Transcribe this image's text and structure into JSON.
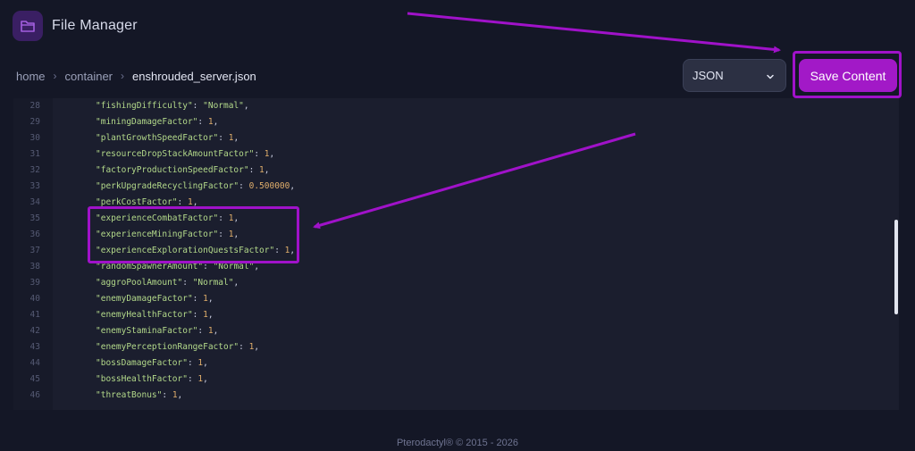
{
  "app": {
    "title": "File Manager",
    "icon": "folder-icon"
  },
  "breadcrumb": {
    "items": [
      "home",
      "container",
      "enshrouded_server.json"
    ]
  },
  "toolbar": {
    "mode_value": "JSON",
    "save_label": "Save Content"
  },
  "editor": {
    "lines": [
      {
        "n": "28",
        "key": "\"fishingDifficulty\"",
        "val": "\"Normal\"",
        "vtype": "str"
      },
      {
        "n": "29",
        "key": "\"miningDamageFactor\"",
        "val": "1",
        "vtype": "num"
      },
      {
        "n": "30",
        "key": "\"plantGrowthSpeedFactor\"",
        "val": "1",
        "vtype": "num"
      },
      {
        "n": "31",
        "key": "\"resourceDropStackAmountFactor\"",
        "val": "1",
        "vtype": "num"
      },
      {
        "n": "32",
        "key": "\"factoryProductionSpeedFactor\"",
        "val": "1",
        "vtype": "num"
      },
      {
        "n": "33",
        "key": "\"perkUpgradeRecyclingFactor\"",
        "val": "0.500000",
        "vtype": "num"
      },
      {
        "n": "34",
        "key": "\"perkCostFactor\"",
        "val": "1",
        "vtype": "num"
      },
      {
        "n": "35",
        "key": "\"experienceCombatFactor\"",
        "val": "1",
        "vtype": "num"
      },
      {
        "n": "36",
        "key": "\"experienceMiningFactor\"",
        "val": "1",
        "vtype": "num"
      },
      {
        "n": "37",
        "key": "\"experienceExplorationQuestsFactor\"",
        "val": "1",
        "vtype": "num"
      },
      {
        "n": "38",
        "key": "\"randomSpawnerAmount\"",
        "val": "\"Normal\"",
        "vtype": "str"
      },
      {
        "n": "39",
        "key": "\"aggroPoolAmount\"",
        "val": "\"Normal\"",
        "vtype": "str"
      },
      {
        "n": "40",
        "key": "\"enemyDamageFactor\"",
        "val": "1",
        "vtype": "num"
      },
      {
        "n": "41",
        "key": "\"enemyHealthFactor\"",
        "val": "1",
        "vtype": "num"
      },
      {
        "n": "42",
        "key": "\"enemyStaminaFactor\"",
        "val": "1",
        "vtype": "num"
      },
      {
        "n": "43",
        "key": "\"enemyPerceptionRangeFactor\"",
        "val": "1",
        "vtype": "num"
      },
      {
        "n": "44",
        "key": "\"bossDamageFactor\"",
        "val": "1",
        "vtype": "num"
      },
      {
        "n": "45",
        "key": "\"bossHealthFactor\"",
        "val": "1",
        "vtype": "num"
      },
      {
        "n": "46",
        "key": "\"threatBonus\"",
        "val": "1",
        "vtype": "num"
      }
    ]
  },
  "footer": {
    "text": "Pterodactyl® © 2015 - 2026"
  },
  "colors": {
    "accent": "#a219c7",
    "annotation": "#a012c9",
    "background": "#141726",
    "editor_bg": "#1b1e2e",
    "key_color": "#b3d98a",
    "number_color": "#e0ae6b"
  }
}
